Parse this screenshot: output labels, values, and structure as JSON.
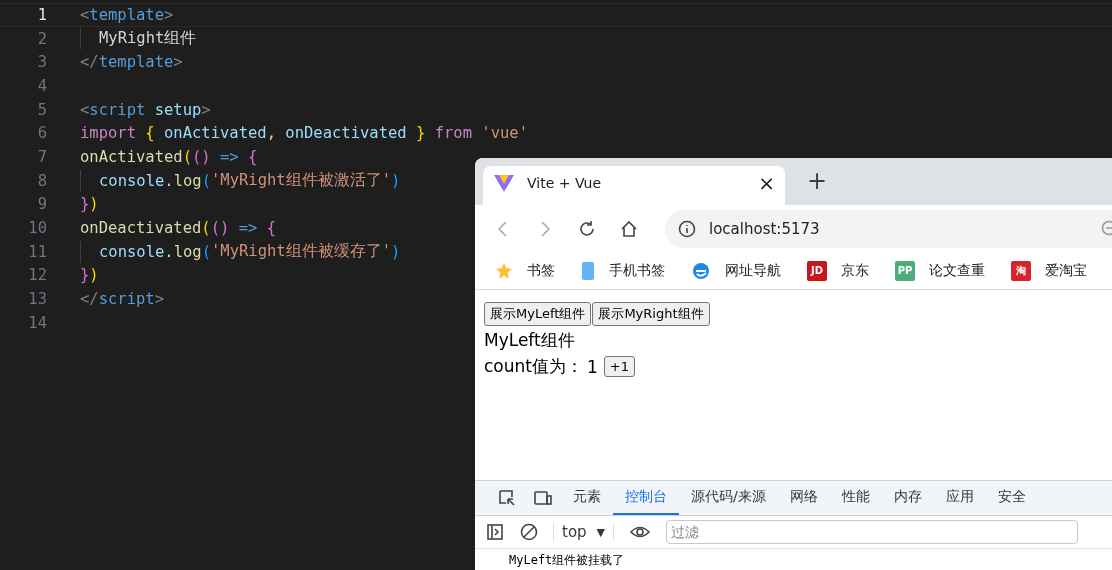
{
  "editor": {
    "lines": [
      {
        "number": "1",
        "selected": true,
        "indent": false,
        "tokens": [
          {
            "kind": "punct",
            "text": "<"
          },
          {
            "kind": "tag",
            "text": "template"
          },
          {
            "kind": "punct",
            "text": ">"
          }
        ]
      },
      {
        "number": "2",
        "selected": false,
        "indent": true,
        "tokens": [
          {
            "kind": "plain",
            "text": "MyRight组件"
          }
        ]
      },
      {
        "number": "3",
        "selected": false,
        "indent": false,
        "tokens": [
          {
            "kind": "punct",
            "text": "</"
          },
          {
            "kind": "tag",
            "text": "template"
          },
          {
            "kind": "punct",
            "text": ">"
          }
        ]
      },
      {
        "number": "4",
        "selected": false,
        "indent": false
      },
      {
        "number": "5",
        "selected": false,
        "indent": false,
        "tokens": [
          {
            "kind": "punct",
            "text": "<"
          },
          {
            "kind": "tag",
            "text": "script"
          },
          {
            "kind": "attr",
            "text": " setup"
          },
          {
            "kind": "punct",
            "text": ">"
          }
        ]
      },
      {
        "number": "6",
        "selected": false,
        "indent": false,
        "tokens": [
          {
            "kind": "keyword",
            "text": "import"
          },
          {
            "kind": "bracket1",
            "text": " {"
          },
          {
            "kind": "var",
            "text": " onActivated"
          },
          {
            "kind": "plain",
            "text": ","
          },
          {
            "kind": "var",
            "text": " onDeactivated"
          },
          {
            "kind": "bracket1",
            "text": " }"
          },
          {
            "kind": "keyword",
            "text": " from"
          },
          {
            "kind": "string",
            "text": " 'vue'"
          }
        ]
      },
      {
        "number": "7",
        "selected": false,
        "indent": false,
        "tokens": [
          {
            "kind": "fn",
            "text": "onActivated"
          },
          {
            "kind": "bracket1",
            "text": "("
          },
          {
            "kind": "bracket2",
            "text": "()"
          },
          {
            "kind": "arrow",
            "text": " =>"
          },
          {
            "kind": "bracket2",
            "text": " {"
          }
        ]
      },
      {
        "number": "8",
        "selected": false,
        "indent": true,
        "tokens": [
          {
            "kind": "var",
            "text": "console"
          },
          {
            "kind": "plain",
            "text": "."
          },
          {
            "kind": "fn",
            "text": "log"
          },
          {
            "kind": "bracket3",
            "text": "("
          },
          {
            "kind": "string",
            "text": "'MyRight组件被激活了'"
          },
          {
            "kind": "bracket3",
            "text": ")"
          }
        ]
      },
      {
        "number": "9",
        "selected": false,
        "indent": false,
        "tokens": [
          {
            "kind": "bracket2",
            "text": "}"
          },
          {
            "kind": "bracket1",
            "text": ")"
          }
        ]
      },
      {
        "number": "10",
        "selected": false,
        "indent": false,
        "tokens": [
          {
            "kind": "fn",
            "text": "onDeactivated"
          },
          {
            "kind": "bracket1",
            "text": "("
          },
          {
            "kind": "bracket2",
            "text": "()"
          },
          {
            "kind": "arrow",
            "text": " =>"
          },
          {
            "kind": "bracket2",
            "text": " {"
          }
        ]
      },
      {
        "number": "11",
        "selected": false,
        "indent": true,
        "tokens": [
          {
            "kind": "var",
            "text": "console"
          },
          {
            "kind": "plain",
            "text": "."
          },
          {
            "kind": "fn",
            "text": "log"
          },
          {
            "kind": "bracket3",
            "text": "("
          },
          {
            "kind": "string",
            "text": "'MyRight组件被缓存了'"
          },
          {
            "kind": "bracket3",
            "text": ")"
          }
        ]
      },
      {
        "number": "12",
        "selected": false,
        "indent": false,
        "tokens": [
          {
            "kind": "bracket2",
            "text": "}"
          },
          {
            "kind": "bracket1",
            "text": ")"
          }
        ]
      },
      {
        "number": "13",
        "selected": false,
        "indent": false,
        "tokens": [
          {
            "kind": "punct",
            "text": "</"
          },
          {
            "kind": "tag",
            "text": "script"
          },
          {
            "kind": "punct",
            "text": ">"
          }
        ]
      },
      {
        "number": "14",
        "selected": false,
        "indent": false
      }
    ]
  },
  "browser": {
    "tab": {
      "title": "Vite + Vue",
      "close": "×"
    },
    "new_tab": "+",
    "address": "localhost:5173",
    "bookmarks": [
      {
        "kind": "star",
        "label": "书签"
      },
      {
        "kind": "phone",
        "label": "手机书签"
      },
      {
        "kind": "globe",
        "label": "网址导航"
      },
      {
        "kind": "logo",
        "logo": "JD",
        "color": "#c8161d",
        "label": "京东"
      },
      {
        "kind": "logo",
        "logo": "PP",
        "color": "#4caf7a",
        "label": "论文查重"
      },
      {
        "kind": "logo",
        "logo": "淘",
        "color": "#d8232a",
        "label": "爱淘宝"
      }
    ],
    "page": {
      "buttons": [
        "展示MyLeft组件",
        "展示MyRight组件"
      ],
      "heading": "MyLeft组件",
      "count_label": "count值为：",
      "count": "1",
      "increment": "+1"
    },
    "devtools": {
      "tabs": [
        {
          "label": "元素",
          "selected": false
        },
        {
          "label": "控制台",
          "selected": true
        },
        {
          "label": "源代码/来源",
          "selected": false
        },
        {
          "label": "网络",
          "selected": false
        },
        {
          "label": "性能",
          "selected": false
        },
        {
          "label": "内存",
          "selected": false
        },
        {
          "label": "应用",
          "selected": false
        },
        {
          "label": "安全",
          "selected": false
        }
      ],
      "context": "top",
      "context_caret": "▼",
      "filter_placeholder": "过滤",
      "log": [
        "MyLeft组件被挂载了"
      ]
    }
  }
}
